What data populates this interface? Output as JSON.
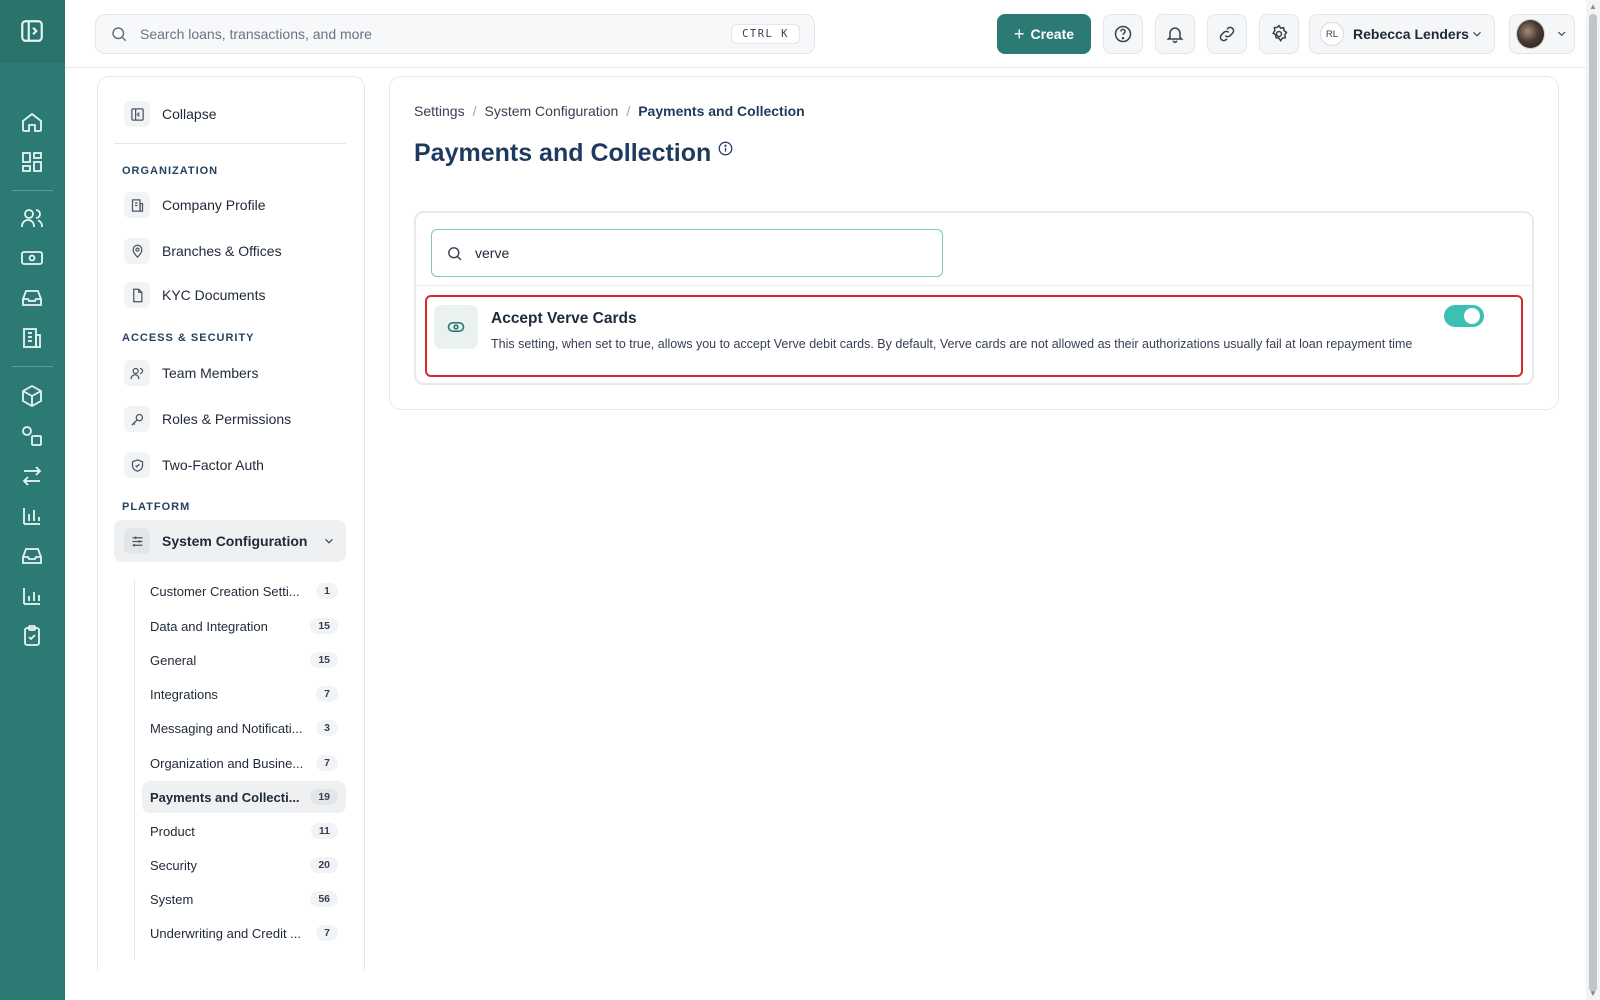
{
  "topbar": {
    "search_placeholder": "Search loans, transactions, and more",
    "shortcut": "CTRL K",
    "create_label": "Create",
    "user_initials": "RL",
    "user_name": "Rebecca Lenders"
  },
  "sidebar": {
    "collapse_label": "Collapse",
    "sections": {
      "organization": "ORGANIZATION",
      "access": "ACCESS & SECURITY",
      "platform": "PLATFORM"
    },
    "items": {
      "company_profile": "Company Profile",
      "branches": "Branches & Offices",
      "kyc": "KYC Documents",
      "team": "Team Members",
      "roles": "Roles & Permissions",
      "two_factor": "Two-Factor Auth",
      "system_config": "System Configuration"
    },
    "sub_items": [
      {
        "label": "Customer Creation Setti...",
        "count": "1"
      },
      {
        "label": "Data and Integration",
        "count": "15"
      },
      {
        "label": "General",
        "count": "15"
      },
      {
        "label": "Integrations",
        "count": "7"
      },
      {
        "label": "Messaging and Notificati...",
        "count": "3"
      },
      {
        "label": "Organization and Busine...",
        "count": "7"
      },
      {
        "label": "Payments and Collecti...",
        "count": "19"
      },
      {
        "label": "Product",
        "count": "11"
      },
      {
        "label": "Security",
        "count": "20"
      },
      {
        "label": "System",
        "count": "56"
      },
      {
        "label": "Underwriting and Credit ...",
        "count": "7"
      }
    ]
  },
  "main": {
    "breadcrumb": [
      "Settings",
      "System Configuration",
      "Payments and Collection"
    ],
    "title": "Payments and Collection",
    "search_value": "verve",
    "setting": {
      "title": "Accept Verve Cards",
      "description": "This setting, when set to true, allows you to accept Verve debit cards. By default, Verve cards are not allowed as their authorizations usually fail at loan repayment time",
      "enabled": true
    }
  },
  "colors": {
    "rail": "#2b7a73",
    "accent": "#2b7a73",
    "toggle_on": "#3cc0b4",
    "highlight_border": "#d9282f"
  }
}
